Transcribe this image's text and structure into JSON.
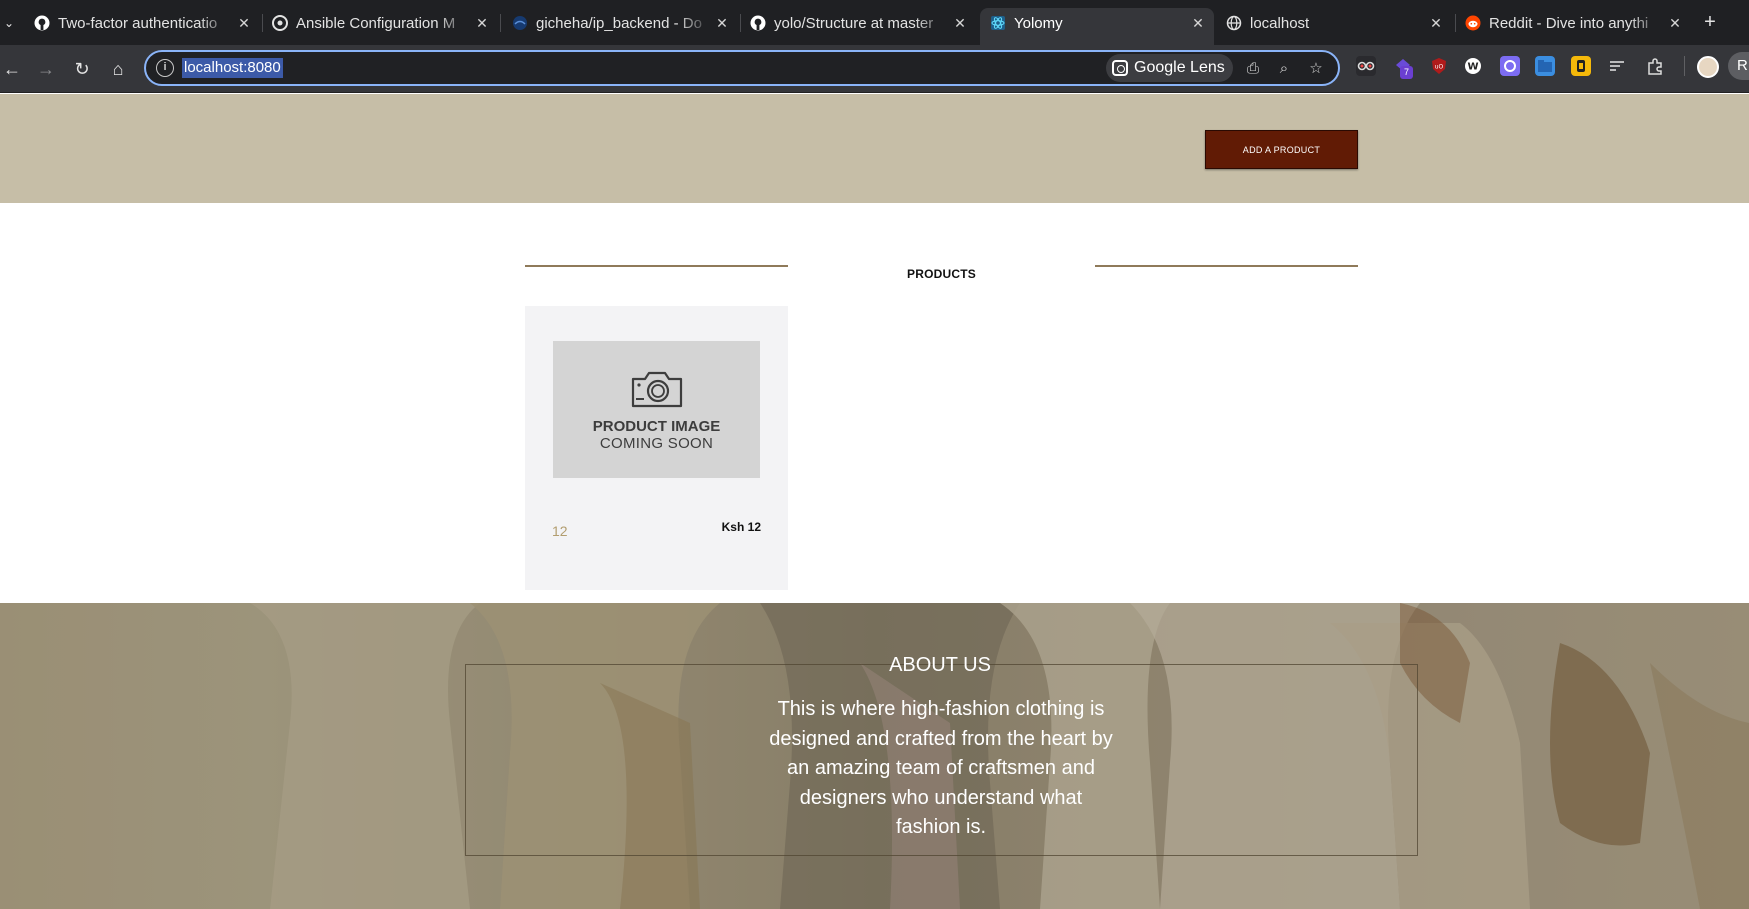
{
  "browser": {
    "tabs": [
      {
        "title": "Two-factor authenticatio",
        "icon": "github-icon",
        "active": false
      },
      {
        "title": "Ansible Configuration M",
        "icon": "ansible-icon",
        "active": false
      },
      {
        "title": "gicheha/ip_backend - Do",
        "icon": "docker-icon",
        "active": false
      },
      {
        "title": "yolo/Structure at master",
        "icon": "github-icon",
        "active": false
      },
      {
        "title": "Yolomy",
        "icon": "react-icon",
        "active": true
      },
      {
        "title": "localhost",
        "icon": "globe-icon",
        "active": false
      },
      {
        "title": "Reddit - Dive into anythi",
        "icon": "reddit-icon",
        "active": false
      }
    ],
    "url": "localhost:8080",
    "lens_label": "Google Lens",
    "profile_initial": "R",
    "extension_badge": "7"
  },
  "page": {
    "hero": {
      "add_button_label": "ADD A PRODUCT"
    },
    "products": {
      "title": "PRODUCTS",
      "items": [
        {
          "image_line1": "PRODUCT IMAGE",
          "image_line2": "COMING SOON",
          "name": "12",
          "price": "Ksh 12"
        }
      ]
    },
    "about": {
      "title": "ABOUT US",
      "text": "This is where high-fashion clothing is designed and crafted from the heart by an amazing team of craftsmen and designers who understand what fashion is."
    }
  },
  "colors": {
    "hero_bg": "#c6bea7",
    "button_bg": "#611b05",
    "rule": "#8f7a5a",
    "card_bg": "#f3f3f5",
    "price_name": "#b29d6f"
  }
}
